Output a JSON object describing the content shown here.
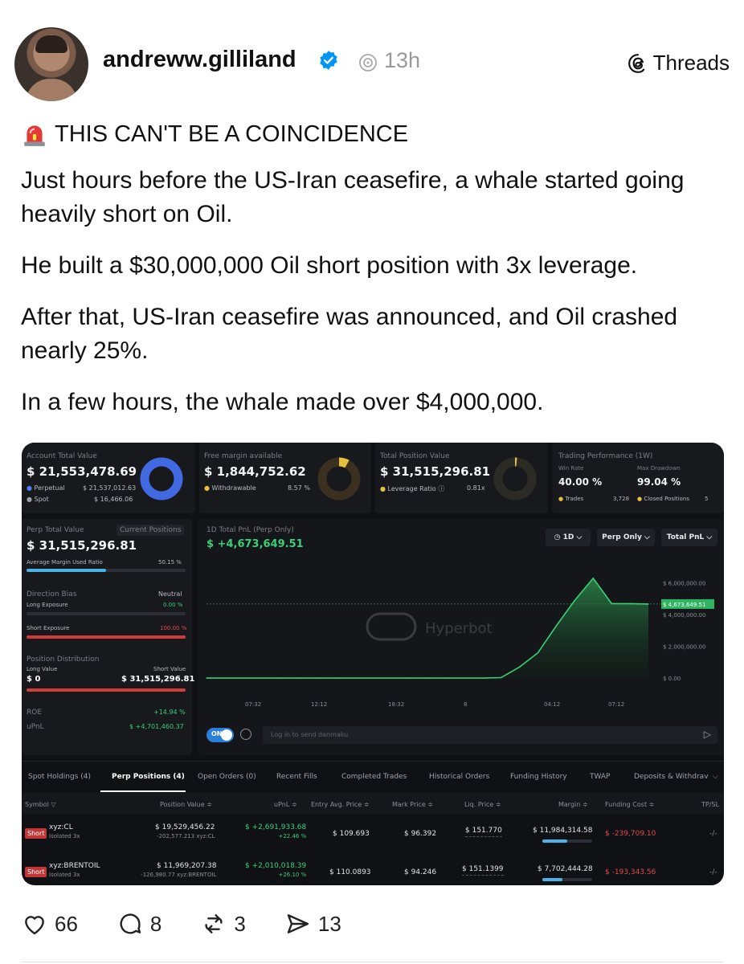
{
  "post": {
    "username": "andreww.gilliland",
    "time": "13h",
    "platform": "Threads",
    "headline": "THIS CAN'T BE A COINCIDENCE",
    "paragraphs": [
      "Just hours before the US-Iran ceasefire, a whale started going heavily short on Oil.",
      "He built a $30,000,000 Oil short position with 3x leverage.",
      "After that, US-Iran ceasefire was announced, and Oil crashed nearly 25%.",
      "In a few hours, the whale made over $4,000,000."
    ]
  },
  "dashboard": {
    "account": {
      "label": "Account Total Value",
      "value": "$ 21,553,478.69",
      "perp_label": "Perpetual",
      "perp_value": "$ 21,537,012.63",
      "spot_label": "Spot",
      "spot_value": "$ 16,466.06",
      "ring_pct": 99.9
    },
    "free_margin": {
      "label": "Free margin available",
      "value": "$ 1,844,752.62",
      "withdraw_label": "Withdrawable",
      "withdraw_value": "8.57 %",
      "ring_pct": 8.57
    },
    "total_position": {
      "label": "Total Position Value",
      "value": "$ 31,515,296.81",
      "lev_label": "Leverage Ratio ⓘ",
      "lev_value": "0.81x",
      "ring_pct": 1
    },
    "performance": {
      "label": "Trading Performance (1W)",
      "win_label": "Win Rate",
      "win_value": "40.00 %",
      "dd_label": "Max Drawdown",
      "dd_value": "99.04 %",
      "trades_label": "Trades",
      "trades_value": "3,728",
      "closed_label": "Closed Positions",
      "closed_value": "5"
    },
    "perp": {
      "label": "Perp Total Value",
      "tab": "Current Positions",
      "value": "$ 31,515,296.81",
      "margin_label": "Average Margin Used Ratio",
      "margin_value": "50.15 %",
      "bias_label": "Direction Bias",
      "bias_value": "Neutral",
      "long_exp_label": "Long Exposure",
      "long_exp_value": "0.00 %",
      "short_exp_label": "Short Exposure",
      "short_exp_value": "100.00 %",
      "dist_label": "Position Distribution",
      "long_val_label": "Long Value",
      "long_val": "$ 0",
      "short_val_label": "Short Value",
      "short_val": "$ 31,515,296.81",
      "roe_label": "ROE",
      "roe_value": "+14.94 %",
      "upnl_label": "uPnL",
      "upnl_value": "$ +4,701,460.37"
    },
    "pnl_chart": {
      "label": "1D Total PnL (Perp Only)",
      "value": "$ +4,673,649.51",
      "period": "1D",
      "scope": "Perp Only",
      "metric": "Total PnL",
      "watermark": "Hyperbot",
      "toggle": "ON",
      "danmaku_placeholder": "Log in to send danmaku"
    },
    "tabs": [
      "Spot Holdings (4)",
      "Perp Positions (4)",
      "Open Orders (0)",
      "Recent Fills",
      "Completed Trades",
      "Historical Orders",
      "Funding History",
      "TWAP",
      "Deposits & Withdrav"
    ],
    "columns": [
      "Symbol ▽",
      "Position Value ≑",
      "uPnL ≑",
      "Entry Avg. Price ≑",
      "Mark Price ≑",
      "Liq. Price ≑",
      "Margin ≑",
      "Funding Cost ≑",
      "TP/SL"
    ],
    "positions": [
      {
        "side": "Short",
        "symbol": "xyz:CL",
        "mode": "Isolated 3x",
        "value": "$ 19,529,456.22",
        "size": "-202,577.213 xyz:CL",
        "upnl": "$ +2,691,933.68",
        "upnl_pct": "+22.46 %",
        "entry": "$ 109.693",
        "mark": "$ 96.392",
        "liq": "$ 151.770",
        "margin": "$ 11,984,314.58",
        "funding": "$ -239,709.10",
        "tpsl": "-/-"
      },
      {
        "side": "Short",
        "symbol": "xyz:BRENTOIL",
        "mode": "Isolated 3x",
        "value": "$ 11,969,207.38",
        "size": "-126,980.77 xyz:BRENTOIL",
        "upnl": "$ +2,010,018.39",
        "upnl_pct": "+26.10 %",
        "entry": "$ 110.0893",
        "mark": "$ 94.246",
        "liq": "$ 151.1399",
        "margin": "$ 7,702,444.28",
        "funding": "$ -193,343.56",
        "tpsl": "-/-"
      }
    ]
  },
  "chart_data": {
    "type": "area",
    "title": "1D Total PnL (Perp Only)",
    "x": [
      "07:32",
      "12:12",
      "18:32",
      "8",
      "04:12",
      "07:12"
    ],
    "y_ticks": [
      "$ 0.00",
      "$ 2,000,000.00",
      "$ 4,000,000.00",
      "$ 6,000,000.00"
    ],
    "ylim": [
      -500000,
      7000000
    ],
    "series": [
      {
        "values": [
          0,
          0,
          0,
          0,
          0,
          0,
          0,
          0,
          0,
          0,
          0,
          0,
          0,
          0,
          0,
          0,
          30000,
          700000,
          1600000,
          3300000,
          4900000,
          6300000,
          4700000,
          4700000,
          4673649.51
        ]
      }
    ],
    "last_label": "$ 4,673,649.51",
    "colors": {
      "line": "#3ccf73",
      "fill": "#1e6b3a"
    }
  },
  "actions": {
    "likes": "66",
    "comments": "8",
    "reposts": "3",
    "shares": "13"
  },
  "colors": {
    "accent_green": "#38d07b",
    "accent_red": "#e34a4a",
    "ring_blue": "#4169e1",
    "verified": "#0095f6"
  }
}
